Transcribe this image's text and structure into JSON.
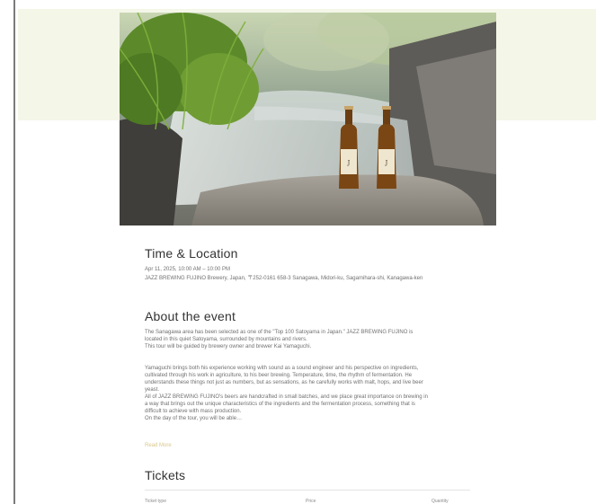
{
  "hero": {
    "image_alt": "Two bottles of JAZZ BREWING FUJINO beer on a rock beside a stream"
  },
  "time_location": {
    "title": "Time & Location",
    "datetime": "Apr 11, 2025, 10:00 AM – 10:00 PM",
    "address": "JAZZ BREWING FUJINO Brewery, Japan, 〒252-0161 658-3 Sanagawa, Midori-ku, Sagamihara-shi, Kanagawa-ken"
  },
  "about": {
    "title": "About the event",
    "p1_l1": "The Sanagawa area has been selected as one of the \"Top 100 Satoyama in Japan.\" JAZZ BREWING FUJINO is",
    "p1_l2": "located in this quiet Satoyama, surrounded by mountains and rivers.",
    "p1_l3": "This tour will be guided by brewery owner and brewer Kai Yamaguchi.",
    "p2_l1": "Yamaguchi brings both his experience working with sound as a sound engineer and his perspective on ingredients,",
    "p2_l2": "cultivated through his work in agriculture, to his beer brewing. Temperature, time, the rhythm of fermentation. He",
    "p2_l3": "understands these things not just as numbers, but as sensations, as he carefully works with malt, hops, and live beer",
    "p2_l4": "yeast.",
    "p2_l5": "All of JAZZ BREWING FUJINO's beers are handcrafted in small batches, and we place great importance on brewing in",
    "p2_l6": "a way that brings out the unique characteristics of the ingredients and the fermentation process, something that is",
    "p2_l7": "difficult to achieve with mass production.",
    "p2_l8": "On the day of the tour, you will be able…",
    "read_more": "Read More"
  },
  "tickets": {
    "title": "Tickets",
    "col_type": "Ticket type",
    "col_price": "Price",
    "col_quantity": "Quantity"
  }
}
